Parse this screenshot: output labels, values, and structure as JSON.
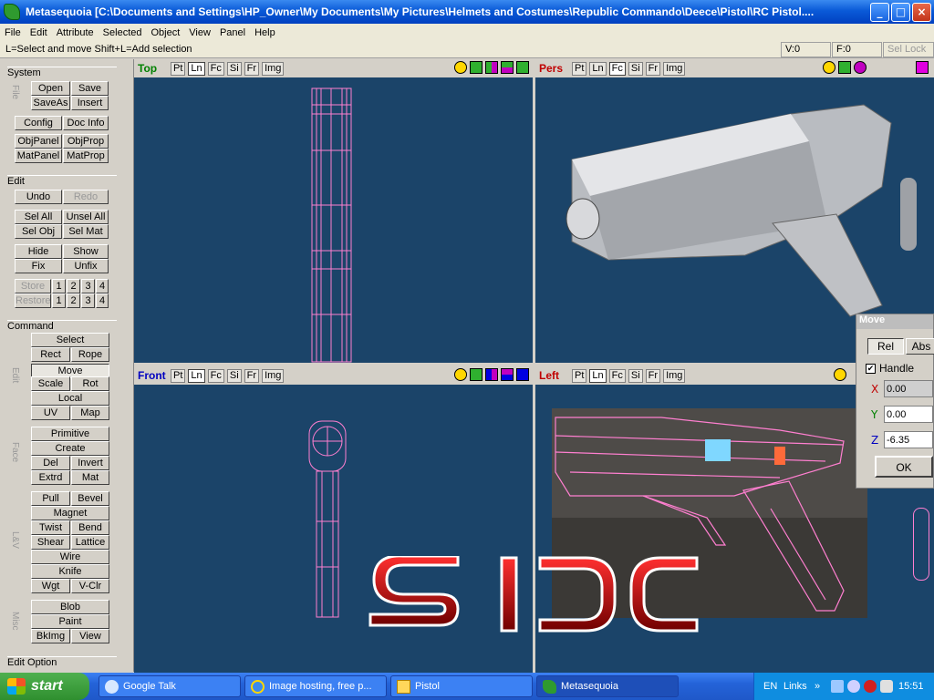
{
  "window": {
    "title": "Metasequoia [C:\\Documents and Settings\\HP_Owner\\My Documents\\My Pictures\\Helmets and Costumes\\Republic Commando\\Deece\\Pistol\\RC Pistol....",
    "minimize": "_",
    "maximize": "□",
    "close": "×"
  },
  "menu": [
    "File",
    "Edit",
    "Attribute",
    "Selected",
    "Object",
    "View",
    "Panel",
    "Help"
  ],
  "status": {
    "hint": "L=Select and move  Shift+L=Add selection",
    "v": "V:0",
    "f": "F:0",
    "sel_lock": "Sel Lock"
  },
  "sidebar": {
    "system_title": "System",
    "file_label": "File",
    "open": "Open",
    "save": "Save",
    "saveas": "SaveAs",
    "insert": "Insert",
    "config": "Config",
    "docinfo": "Doc Info",
    "objpanel": "ObjPanel",
    "objprop": "ObjProp",
    "matpanel": "MatPanel",
    "matprop": "MatProp",
    "edit_title": "Edit",
    "undo": "Undo",
    "redo": "Redo",
    "selall": "Sel All",
    "unselall": "Unsel All",
    "selobj": "Sel Obj",
    "selmat": "Sel Mat",
    "hide": "Hide",
    "show": "Show",
    "fix": "Fix",
    "unfix": "Unfix",
    "store": "Store",
    "restore": "Restore",
    "nums": [
      "1",
      "2",
      "3",
      "4"
    ],
    "command_title": "Command",
    "edit_label": "Edit",
    "select": "Select",
    "rect": "Rect",
    "rope": "Rope",
    "move": "Move",
    "scale": "Scale",
    "rot": "Rot",
    "local": "Local",
    "uv": "UV",
    "map": "Map",
    "face_label": "Face",
    "primitive": "Primitive",
    "create": "Create",
    "del": "Del",
    "invert": "Invert",
    "extrd": "Extrd",
    "mat": "Mat",
    "lv_label": "L&V",
    "pull": "Pull",
    "bevel": "Bevel",
    "magnet": "Magnet",
    "twist": "Twist",
    "bend": "Bend",
    "shear": "Shear",
    "lattice": "Lattice",
    "wire": "Wire",
    "knife": "Knife",
    "wgt": "Wgt",
    "vclr": "V-Clr",
    "misc_label": "Misc",
    "blob": "Blob",
    "paint": "Paint",
    "bkimg": "BkImg",
    "view": "View",
    "editoption_title": "Edit Option"
  },
  "viewports": {
    "top": {
      "title": "Top",
      "title_color": "#008000"
    },
    "pers": {
      "title": "Pers",
      "title_color": "#c00000"
    },
    "front": {
      "title": "Front",
      "title_color": "#0000c0"
    },
    "left": {
      "title": "Left",
      "title_color": "#c00000"
    },
    "modes": [
      "Pt",
      "Ln",
      "Fc",
      "Si",
      "Fr",
      "Img"
    ]
  },
  "move_dialog": {
    "title": "Move",
    "rel": "Rel",
    "abs": "Abs",
    "handle": "Handle",
    "x_label": "X",
    "x_value": "0.00",
    "y_label": "Y",
    "y_value": "0.00",
    "z_label": "Z",
    "z_value": "-6.35",
    "ok": "OK"
  },
  "watermark": "SJC",
  "taskbar": {
    "start": "start",
    "tasks": [
      "Google Talk",
      "Image hosting, free p...",
      "Pistol",
      "Metasequoia"
    ],
    "lang": "EN",
    "links": "Links",
    "clock": "15:51"
  },
  "colors": {
    "viewport_bg": "#1b4469",
    "wire": "#ff7fd0",
    "accent": "#0a5ad8"
  }
}
